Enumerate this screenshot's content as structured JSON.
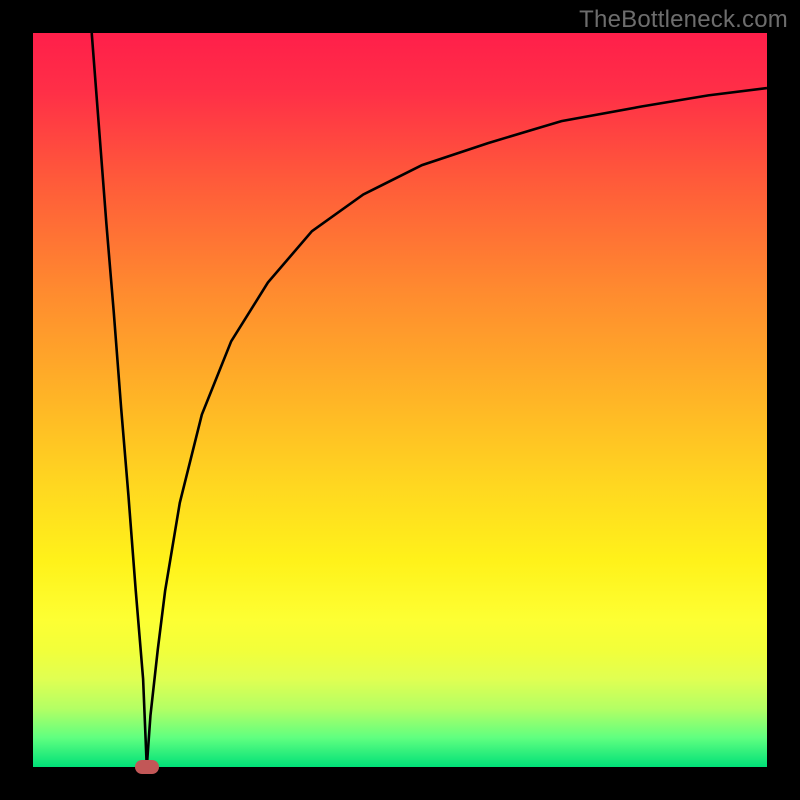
{
  "watermark": "TheBottleneck.com",
  "colors": {
    "curve_stroke": "#000000",
    "marker_fill": "#c25757"
  },
  "chart_data": {
    "type": "line",
    "title": "",
    "xlabel": "",
    "ylabel": "",
    "xlim": [
      0,
      100
    ],
    "ylim": [
      0,
      100
    ],
    "grid": false,
    "legend": false,
    "series": [
      {
        "name": "left-branch",
        "x": [
          8,
          9,
          10,
          11,
          12,
          13,
          14,
          15,
          15.5
        ],
        "y": [
          100,
          87,
          74,
          62,
          49,
          37,
          24,
          12,
          0
        ]
      },
      {
        "name": "right-branch",
        "x": [
          15.5,
          16,
          17,
          18,
          20,
          23,
          27,
          32,
          38,
          45,
          53,
          62,
          72,
          83,
          92,
          100
        ],
        "y": [
          0,
          7,
          16,
          24,
          36,
          48,
          58,
          66,
          73,
          78,
          82,
          85,
          88,
          90,
          91.5,
          92.5
        ]
      }
    ],
    "marker": {
      "x": 15.5,
      "y": 0
    }
  }
}
